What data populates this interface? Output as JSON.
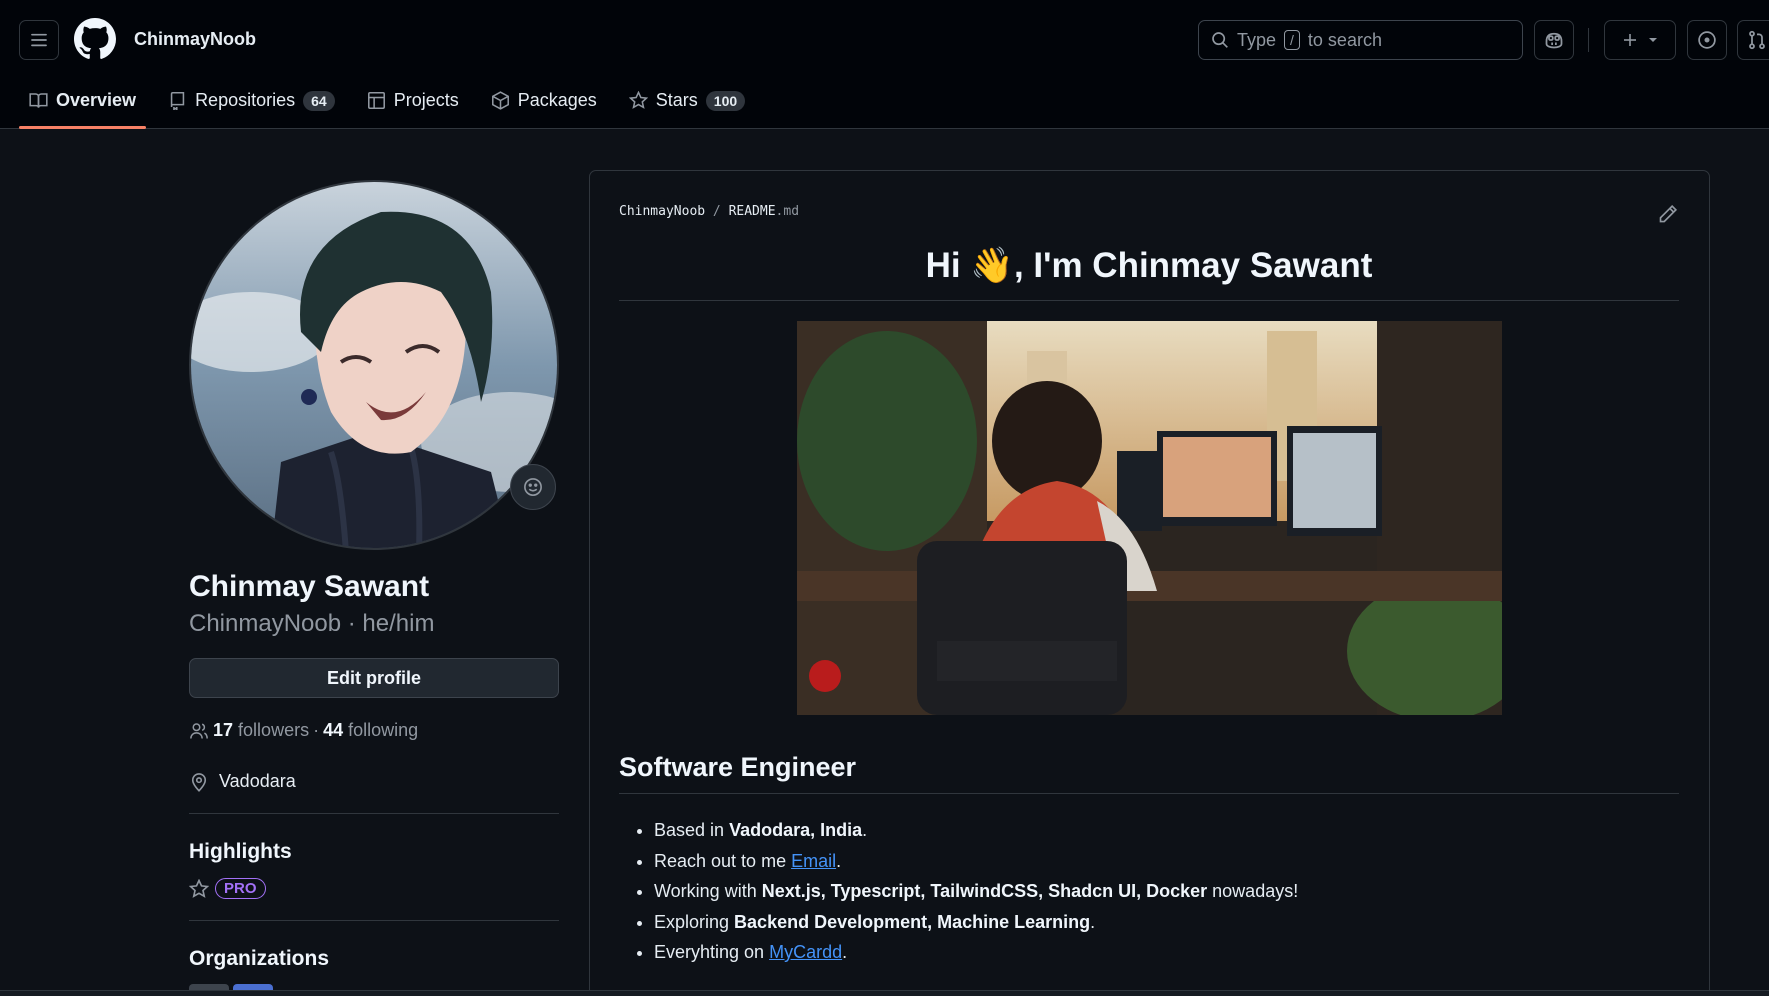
{
  "header": {
    "username": "ChinmayNoob",
    "search": {
      "prefix": "Type",
      "key": "/",
      "suffix": "to search"
    }
  },
  "tabs": [
    {
      "label": "Overview",
      "icon": "book-icon",
      "active": true
    },
    {
      "label": "Repositories",
      "icon": "repo-icon",
      "count": "64"
    },
    {
      "label": "Projects",
      "icon": "table-icon"
    },
    {
      "label": "Packages",
      "icon": "package-icon"
    },
    {
      "label": "Stars",
      "icon": "star-icon",
      "count": "100"
    }
  ],
  "profile": {
    "full_name": "Chinmay Sawant",
    "login_pronouns": "ChinmayNoob · he/him",
    "edit_label": "Edit profile",
    "followers_count": "17",
    "followers_label": "followers",
    "dot": "·",
    "following_count": "44",
    "following_label": "following",
    "location": "Vadodara",
    "highlights_title": "Highlights",
    "pro_badge": "PRO",
    "organizations_title": "Organizations"
  },
  "readme": {
    "path_owner": "ChinmayNoob",
    "path_sep": "/",
    "path_file": "README",
    "path_ext": ".md",
    "title_hi": "Hi",
    "title_wave": "👋",
    "title_rest": ", I'm Chinmay Sawant",
    "section_title": "Software Engineer",
    "items": [
      {
        "pre": "Based in ",
        "bold": "Vadodara, India",
        "post": "."
      },
      {
        "pre": "Reach out to me ",
        "link": "Email",
        "post": "."
      },
      {
        "pre": "Working with ",
        "bold": "Next.js, Typescript, TailwindCSS, Shadcn UI, Docker",
        "post": " nowadays!"
      },
      {
        "pre": "Exploring ",
        "bold": "Backend Development, Machine Learning",
        "post": "."
      },
      {
        "pre": "Everyhting on ",
        "link": "MyCardd",
        "post": "."
      }
    ]
  },
  "colors": {
    "accent": "#f78166",
    "link": "#4493f8",
    "pro": "#a371f7"
  }
}
